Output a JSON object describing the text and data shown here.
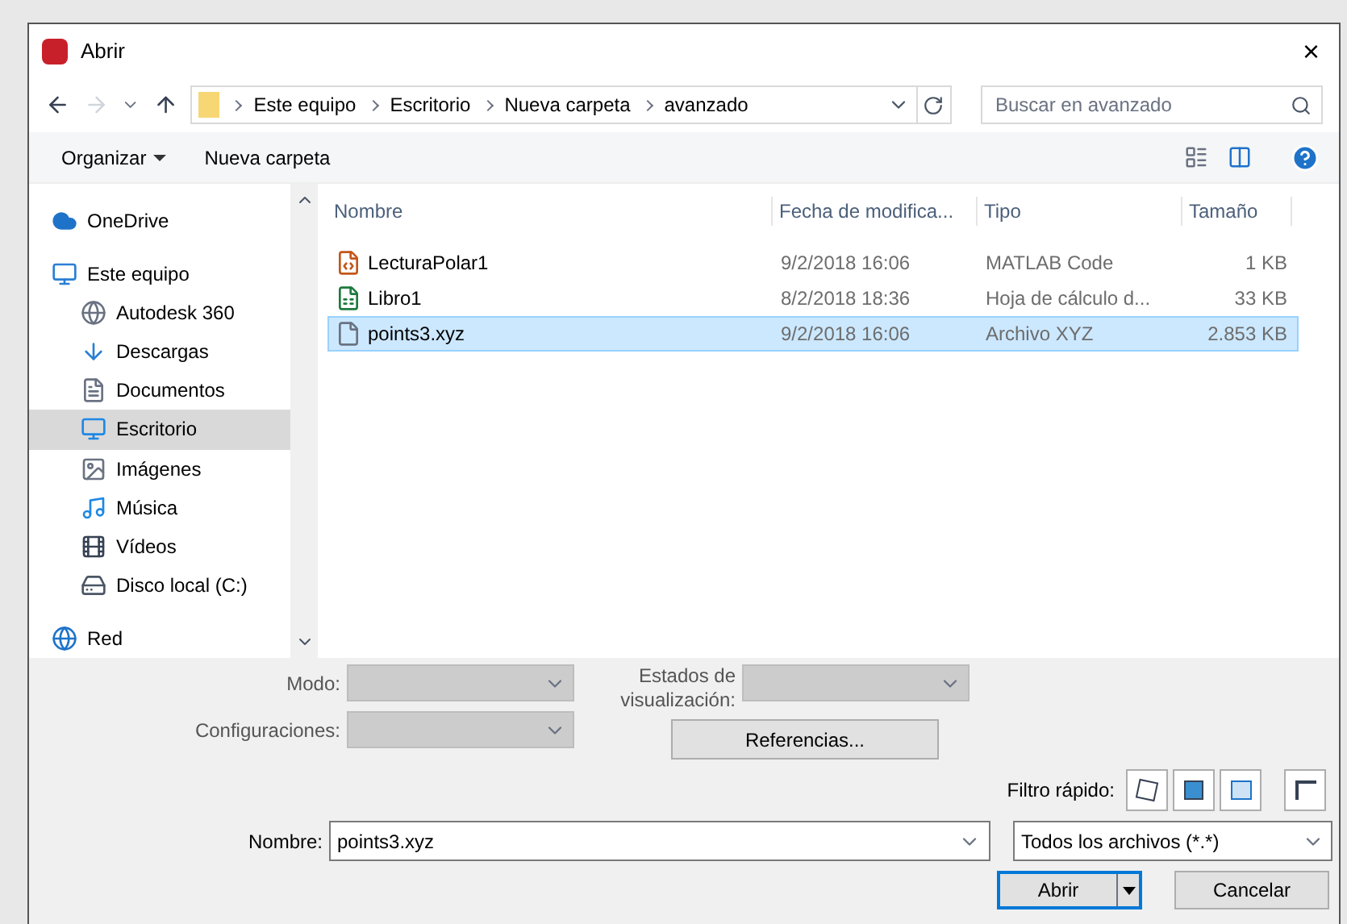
{
  "window": {
    "title": "Abrir",
    "close": "×"
  },
  "breadcrumb": [
    "Este equipo",
    "Escritorio",
    "Nueva carpeta",
    "avanzado"
  ],
  "search": {
    "placeholder": "Buscar en avanzado"
  },
  "toolbar": {
    "organize": "Organizar",
    "new_folder": "Nueva carpeta"
  },
  "sidebar": {
    "items": [
      {
        "label": "OneDrive",
        "kind": "cloud",
        "selected": false
      },
      {
        "label": "Este equipo",
        "kind": "computer",
        "selected": false,
        "children": [
          {
            "label": "Autodesk 360",
            "kind": "autodesk",
            "selected": false
          },
          {
            "label": "Descargas",
            "kind": "download",
            "selected": false
          },
          {
            "label": "Documentos",
            "kind": "document",
            "selected": false
          },
          {
            "label": "Escritorio",
            "kind": "desktop",
            "selected": true
          },
          {
            "label": "Imágenes",
            "kind": "image",
            "selected": false
          },
          {
            "label": "Música",
            "kind": "music",
            "selected": false
          },
          {
            "label": "Vídeos",
            "kind": "video",
            "selected": false
          },
          {
            "label": "Disco local (C:)",
            "kind": "drive",
            "selected": false
          }
        ]
      },
      {
        "label": "Red",
        "kind": "network",
        "selected": false
      }
    ]
  },
  "table": {
    "columns": [
      "Nombre",
      "Fecha de modifica...",
      "Tipo",
      "Tamaño"
    ],
    "rows": [
      {
        "name": "LecturaPolar1",
        "kind": "matlab",
        "date": "9/2/2018 16:06",
        "type": "MATLAB Code",
        "size": "1 KB",
        "selected": false
      },
      {
        "name": "Libro1",
        "kind": "excel",
        "date": "8/2/2018 18:36",
        "type": "Hoja de cálculo d...",
        "size": "33 KB",
        "selected": false
      },
      {
        "name": "points3.xyz",
        "kind": "file",
        "date": "9/2/2018 16:06",
        "type": "Archivo XYZ",
        "size": "2.853 KB",
        "selected": true
      }
    ]
  },
  "options": {
    "mode_label": "Modo:",
    "configs_label": "Configuraciones:",
    "display_states_label": "Estados de visualización:",
    "references": "Referencias...",
    "quick_filter_label": "Filtro rápido:"
  },
  "filename": {
    "label": "Nombre:",
    "value": "points3.xyz"
  },
  "filter": {
    "value": "Todos los archivos (*.*)"
  },
  "buttons": {
    "open": "Abrir",
    "cancel": "Cancelar"
  }
}
